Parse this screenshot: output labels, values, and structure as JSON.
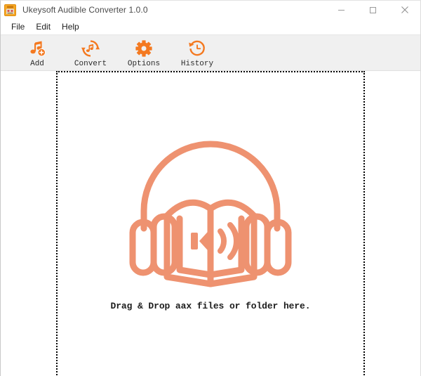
{
  "window": {
    "title": "Ukeysoft Audible Converter 1.0.0",
    "app_icon": "app-logo-icon",
    "controls": [
      {
        "name": "minimize-button",
        "icon": "minimize-icon",
        "label": "Minimize"
      },
      {
        "name": "maximize-button",
        "icon": "maximize-icon",
        "label": "Maximize"
      },
      {
        "name": "close-button",
        "icon": "close-icon",
        "label": "Close"
      }
    ]
  },
  "menu": {
    "items": [
      {
        "label": "File"
      },
      {
        "label": "Edit"
      },
      {
        "label": "Help"
      }
    ]
  },
  "toolbar": {
    "buttons": [
      {
        "label": "Add",
        "icon": "music-note-add-icon"
      },
      {
        "label": "Convert",
        "icon": "convert-refresh-icon"
      },
      {
        "label": "Options",
        "icon": "gear-icon"
      },
      {
        "label": "History",
        "icon": "history-clock-icon"
      }
    ]
  },
  "drop_zone": {
    "message": "Drag & Drop aax files or folder here.",
    "illustration": "audiobook-headphones-icon"
  },
  "colors": {
    "toolbar_icon_orange": "#f47920",
    "illustration_salmon": "#ee9270",
    "toolbar_background": "#f0f0f0",
    "window_background": "#ffffff",
    "dropzone_border": "#000000",
    "title_text": "#4a4a4a",
    "menu_text": "#202020"
  }
}
